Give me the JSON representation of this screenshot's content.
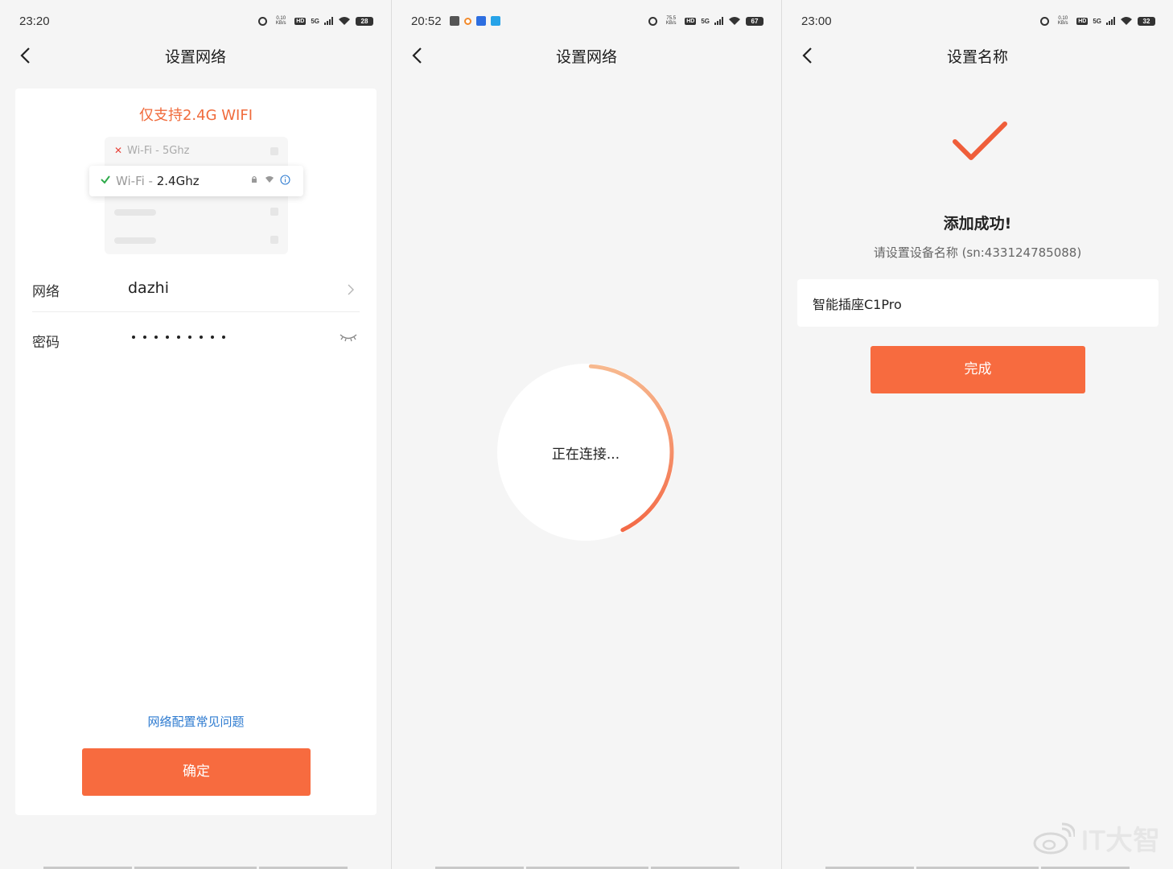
{
  "screens": [
    {
      "status": {
        "time": "23:20",
        "speed": "0.10 KB/s",
        "hd": "HD",
        "network": "5G",
        "battery": "28"
      },
      "nav": {
        "title": "设置网络"
      },
      "notice": "仅支持2.4G WIFI",
      "illustration": {
        "band5g_prefix": "Wi-Fi - ",
        "band5g": "5Ghz",
        "band24_prefix": "Wi-Fi - ",
        "band24": "2.4Ghz"
      },
      "form": {
        "network_label": "网络",
        "network_value": "dazhi",
        "password_label": "密码",
        "password_mask_length": 9
      },
      "faq_link": "网络配置常见问题",
      "confirm_label": "确定"
    },
    {
      "status": {
        "time": "20:52",
        "speed": "75.5 KB/s",
        "hd": "HD",
        "network": "5G",
        "battery": "67"
      },
      "nav": {
        "title": "设置网络"
      },
      "connecting_text": "正在连接...",
      "progress_fraction": 0.42
    },
    {
      "status": {
        "time": "23:00",
        "speed": "0.10 KB/s",
        "hd": "HD",
        "network": "5G",
        "battery": "32"
      },
      "nav": {
        "title": "设置名称"
      },
      "success_title": "添加成功!",
      "success_sub": "请设置设备名称 (sn:433124785088)",
      "device_name_value": "智能插座C1Pro",
      "done_label": "完成"
    }
  ],
  "watermark": "IT大智",
  "colors": {
    "accent": "#f76b3f",
    "notice": "#f06b3c",
    "link": "#2e7bd0",
    "success_check": "#ef5e3a",
    "wifi_ok": "#2eaa4a",
    "wifi_bad": "#e8433a"
  }
}
